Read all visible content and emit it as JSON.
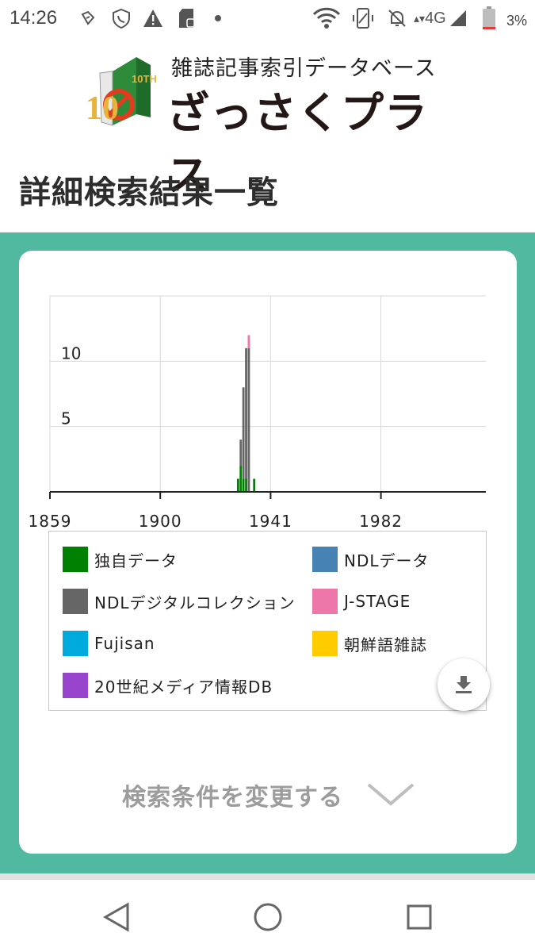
{
  "status_bar": {
    "time": "14:26",
    "battery_percent": "3%",
    "network": "4G"
  },
  "header": {
    "logo_tagline": "雑誌記事索引データベース",
    "logo_name": "ざっさくプラス",
    "logo_badge": "10TH"
  },
  "page_title": "詳細検索結果一覧",
  "chart_data": {
    "type": "bar",
    "stacked": true,
    "x_ticks": [
      "1859",
      "1900",
      "1941",
      "1982"
    ],
    "y_ticks": [
      "5",
      "10"
    ],
    "xlim": [
      1859,
      2021
    ],
    "ylim": [
      0,
      15
    ],
    "grid": true,
    "series": [
      {
        "name": "独自データ",
        "color": "#008000",
        "points": [
          [
            1929,
            1
          ],
          [
            1930,
            2
          ],
          [
            1931,
            1
          ],
          [
            1932,
            1
          ],
          [
            1935,
            1
          ]
        ]
      },
      {
        "name": "NDLデジタルコレクション",
        "color": "#666666",
        "points": [
          [
            1930,
            2
          ],
          [
            1931,
            7
          ],
          [
            1932,
            10
          ],
          [
            1933,
            11
          ]
        ]
      },
      {
        "name": "J-STAGE",
        "color": "#ee77aa",
        "points": [
          [
            1933,
            1
          ]
        ]
      }
    ]
  },
  "legend": [
    {
      "label": "独自データ",
      "color": "#008000"
    },
    {
      "label": "NDLデータ",
      "color": "#4682b4"
    },
    {
      "label": "NDLデジタルコレクション",
      "color": "#666666"
    },
    {
      "label": "J-STAGE",
      "color": "#ee77aa"
    },
    {
      "label": "Fujisan",
      "color": "#00aadd"
    },
    {
      "label": "朝鮮語雑誌",
      "color": "#ffcc00"
    },
    {
      "label": "20世紀メディア情報DB",
      "color": "#9944cc"
    }
  ],
  "change_conditions_label": "検索条件を変更する",
  "icons": {
    "download": "download-icon",
    "chevron": "chevron-down-icon",
    "back": "back-icon",
    "home": "home-icon",
    "recents": "recents-icon"
  }
}
